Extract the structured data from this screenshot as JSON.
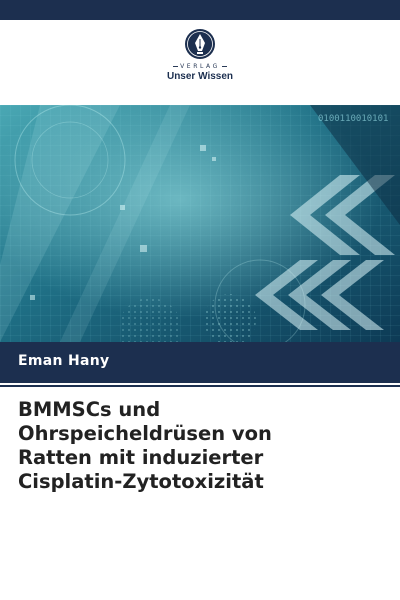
{
  "publisher": {
    "imprint_label": "VERLAG",
    "name": "Unser Wissen",
    "logo_icon": "fountain-pen-nib-icon",
    "brand_color": "#1c2f4f"
  },
  "cover": {
    "art_icon": "digital-tech-abstract-art",
    "binary_text": "0100110010101"
  },
  "book": {
    "author": "Eman Hany",
    "title": "BMMSCs und\nOhrspeicheldrüsen von\nRatten mit induzierter\nCisplatin-Zytotoxizität"
  }
}
